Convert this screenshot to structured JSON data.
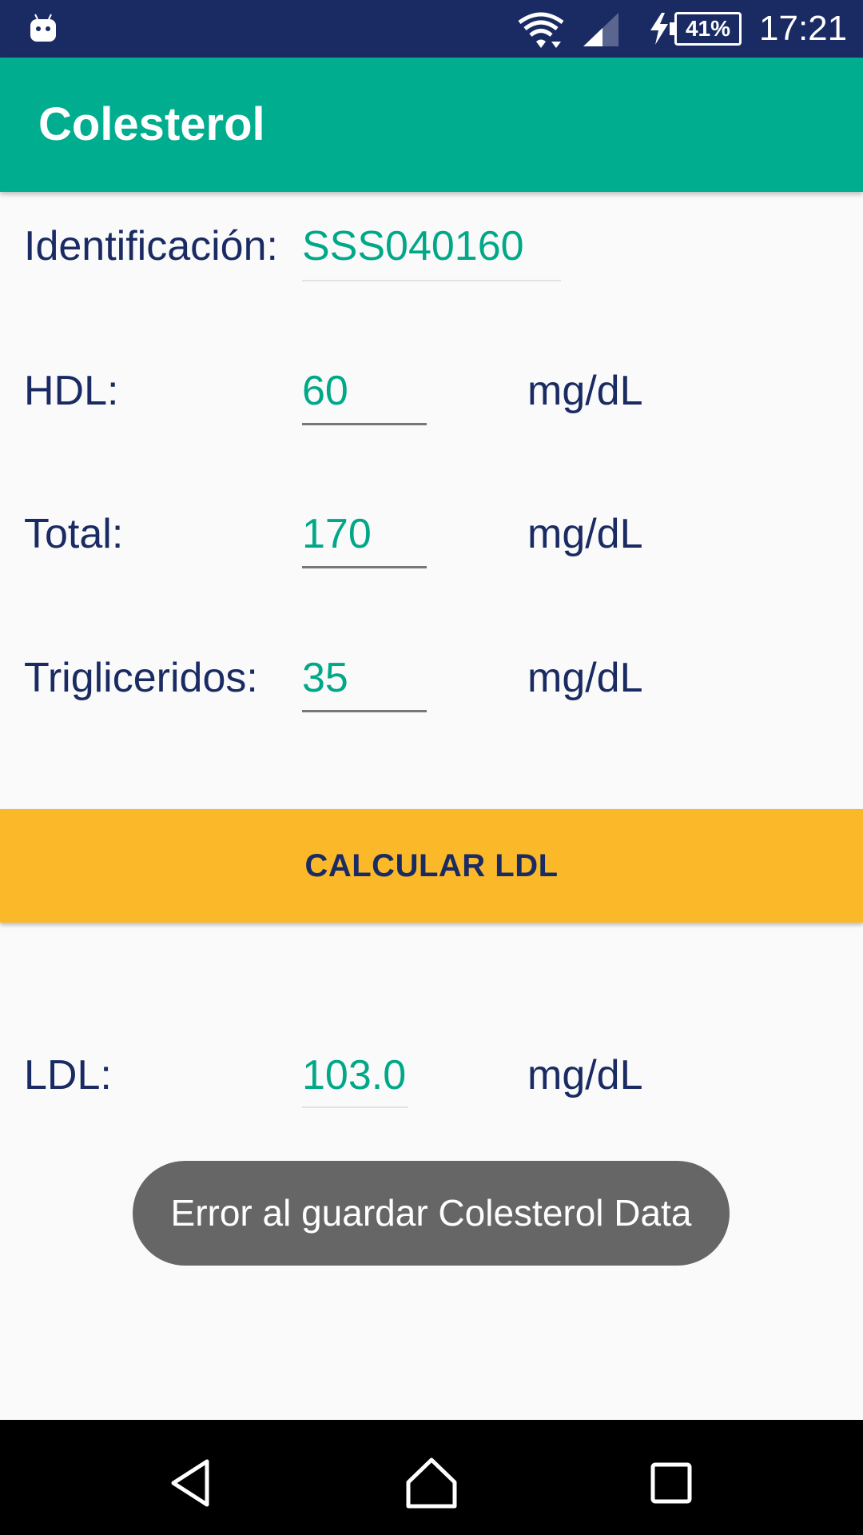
{
  "status_bar": {
    "battery": "41%",
    "clock": "17:21",
    "icons": [
      "android-icon",
      "wifi-icon",
      "signal-icon",
      "charging-bolt-icon"
    ]
  },
  "app_bar": {
    "title": "Colesterol"
  },
  "form": {
    "identificacion": {
      "label": "Identificación:",
      "value": "SSS040160"
    },
    "hdl": {
      "label": "HDL:",
      "value": "60",
      "unit": "mg/dL"
    },
    "total": {
      "label": "Total:",
      "value": "170",
      "unit": "mg/dL"
    },
    "trigliceridos": {
      "label": "Trigliceridos:",
      "value": "35",
      "unit": "mg/dL"
    }
  },
  "button": {
    "label": "CALCULAR LDL"
  },
  "result": {
    "label": "LDL:",
    "value": "103.0",
    "unit": "mg/dL"
  },
  "toast": {
    "message": "Error al guardar Colesterol Data"
  },
  "nav_bar": {
    "icons": [
      "back-icon",
      "home-icon",
      "recents-icon"
    ]
  },
  "colors": {
    "primary": "#00ad8e",
    "status_bar": "#1a2b63",
    "accent": "#fbb829",
    "value_text": "#00a888"
  }
}
